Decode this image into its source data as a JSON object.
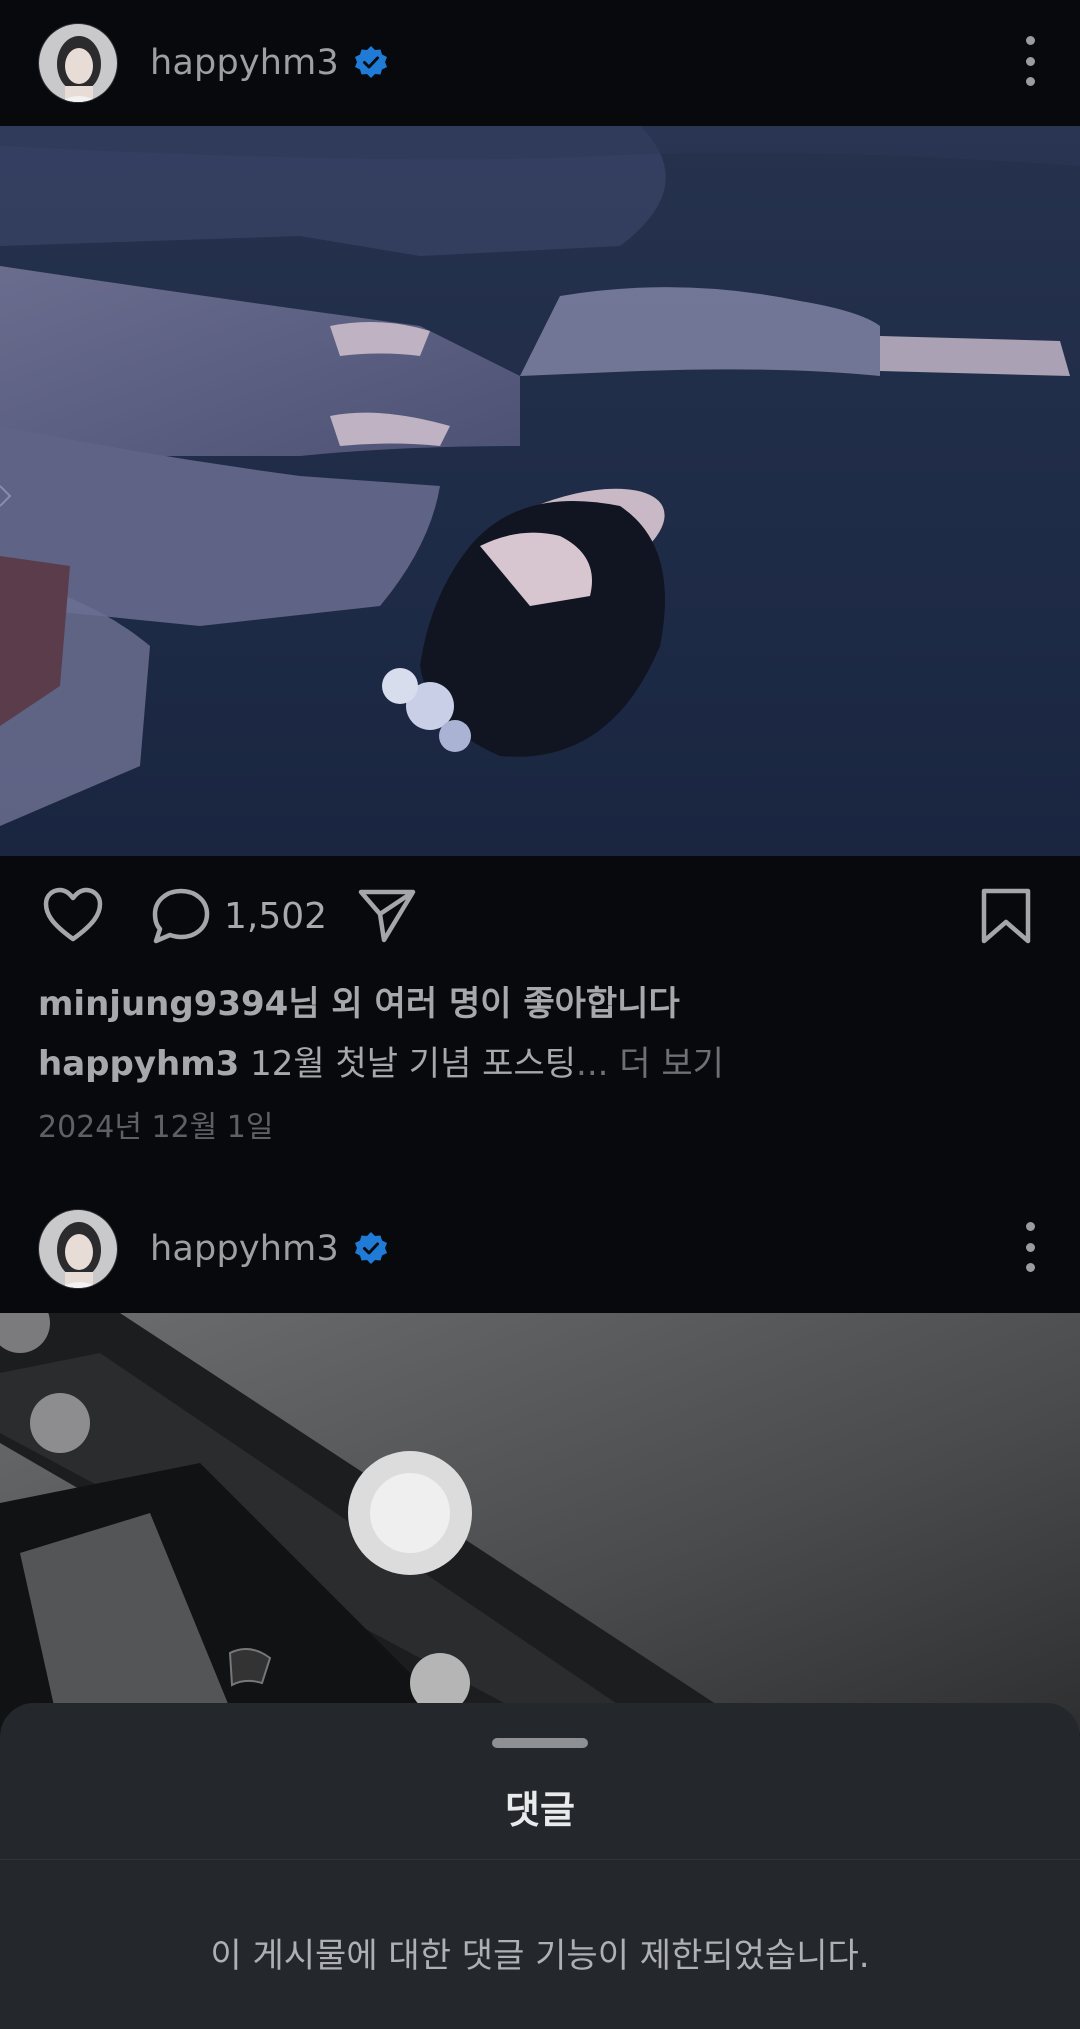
{
  "posts": [
    {
      "username": "happyhm3",
      "verified": true,
      "comment_count": "1,502",
      "likes_text": "minjung9394님 외 여러 명이 좋아합니다",
      "caption_user": "happyhm3",
      "caption_text": "12월 첫날 기념 포스팅",
      "caption_ellipsis": "...",
      "more_label": "더 보기",
      "date": "2024년 12월 1일"
    },
    {
      "username": "happyhm3",
      "verified": true
    }
  ],
  "icons": {
    "like": "heart-icon",
    "comment": "comment-icon",
    "share": "send-icon",
    "save": "bookmark-icon",
    "verified": "verified-badge-icon",
    "more": "more-vertical-icon"
  },
  "colors": {
    "background": "#08090c",
    "verified": "#1f7bd6",
    "sheet": "#24272c"
  },
  "comments_sheet": {
    "title": "댓글",
    "message": "이 게시물에 대한 댓글 기능이 제한되었습니다."
  }
}
